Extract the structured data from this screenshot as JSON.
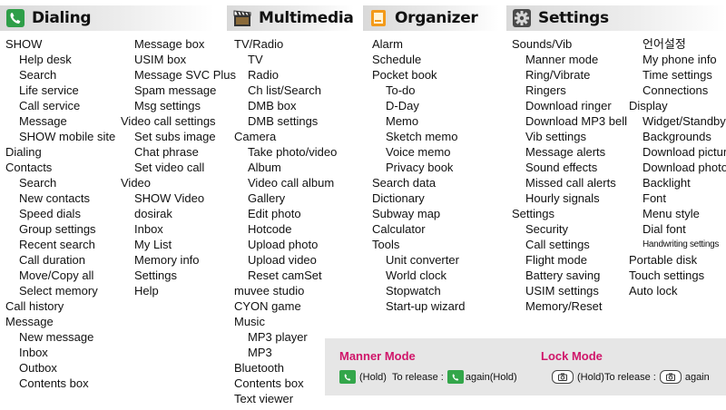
{
  "sections": {
    "dialing": "Dialing",
    "multimedia": "Multimedia",
    "organizer": "Organizer",
    "settings": "Settings"
  },
  "dialing_col1": [
    {
      "t": "SHOW",
      "i": 0
    },
    {
      "t": "Help desk",
      "i": 1
    },
    {
      "t": "Search",
      "i": 1
    },
    {
      "t": "Life service",
      "i": 1
    },
    {
      "t": "Call service",
      "i": 1
    },
    {
      "t": "Message",
      "i": 1
    },
    {
      "t": "SHOW mobile site",
      "i": 1
    },
    {
      "t": "Dialing",
      "i": 0
    },
    {
      "t": "Contacts",
      "i": 0
    },
    {
      "t": "Search",
      "i": 1
    },
    {
      "t": "New contacts",
      "i": 1
    },
    {
      "t": "Speed dials",
      "i": 1
    },
    {
      "t": "Group settings",
      "i": 1
    },
    {
      "t": "Recent search",
      "i": 1
    },
    {
      "t": "Call duration",
      "i": 1
    },
    {
      "t": "Move/Copy all",
      "i": 1
    },
    {
      "t": "Select memory",
      "i": 1
    },
    {
      "t": "Call history",
      "i": 0
    },
    {
      "t": "Message",
      "i": 0
    },
    {
      "t": "New message",
      "i": 1
    },
    {
      "t": "Inbox",
      "i": 1
    },
    {
      "t": "Outbox",
      "i": 1
    },
    {
      "t": "Contents box",
      "i": 1
    }
  ],
  "dialing_col2": [
    {
      "t": "Message box",
      "i": 1
    },
    {
      "t": "USIM box",
      "i": 1
    },
    {
      "t": "Message SVC Plus",
      "i": 1
    },
    {
      "t": "Spam message",
      "i": 1
    },
    {
      "t": "Msg settings",
      "i": 1
    },
    {
      "t": "Video call settings",
      "i": 0
    },
    {
      "t": "Set subs image",
      "i": 1
    },
    {
      "t": "Chat phrase",
      "i": 1
    },
    {
      "t": "Set video call",
      "i": 1
    },
    {
      "t": "Video",
      "i": 0
    },
    {
      "t": "SHOW Video",
      "i": 1
    },
    {
      "t": "dosirak",
      "i": 1
    },
    {
      "t": "Inbox",
      "i": 1
    },
    {
      "t": "My List",
      "i": 1
    },
    {
      "t": "Memory info",
      "i": 1
    },
    {
      "t": "Settings",
      "i": 1
    },
    {
      "t": "Help",
      "i": 1
    }
  ],
  "multimedia_col": [
    {
      "t": "TV/Radio",
      "i": 0
    },
    {
      "t": "TV",
      "i": 1
    },
    {
      "t": "Radio",
      "i": 1
    },
    {
      "t": "Ch list/Search",
      "i": 1
    },
    {
      "t": "DMB box",
      "i": 1
    },
    {
      "t": "DMB settings",
      "i": 1
    },
    {
      "t": "Camera",
      "i": 0
    },
    {
      "t": "Take photo/video",
      "i": 1
    },
    {
      "t": "Album",
      "i": 1
    },
    {
      "t": "Video call album",
      "i": 1
    },
    {
      "t": "Gallery",
      "i": 1
    },
    {
      "t": "Edit photo",
      "i": 1
    },
    {
      "t": "Hotcode",
      "i": 1
    },
    {
      "t": "Upload photo",
      "i": 1
    },
    {
      "t": "Upload video",
      "i": 1
    },
    {
      "t": "Reset camSet",
      "i": 1
    },
    {
      "t": "muvee studio",
      "i": 0
    },
    {
      "t": "CYON game",
      "i": 0
    },
    {
      "t": "Music",
      "i": 0
    },
    {
      "t": "MP3 player",
      "i": 1
    },
    {
      "t": "MP3",
      "i": 1
    },
    {
      "t": "Bluetooth",
      "i": 0
    },
    {
      "t": "Contents box",
      "i": 0
    },
    {
      "t": "Text viewer",
      "i": 0
    }
  ],
  "organizer_col": [
    {
      "t": "Alarm",
      "i": 0
    },
    {
      "t": "Schedule",
      "i": 0
    },
    {
      "t": "Pocket book",
      "i": 0
    },
    {
      "t": "To-do",
      "i": 1
    },
    {
      "t": "D-Day",
      "i": 1
    },
    {
      "t": "Memo",
      "i": 1
    },
    {
      "t": "Sketch memo",
      "i": 1
    },
    {
      "t": "Voice memo",
      "i": 1
    },
    {
      "t": "Privacy book",
      "i": 1
    },
    {
      "t": "Search data",
      "i": 0
    },
    {
      "t": "Dictionary",
      "i": 0
    },
    {
      "t": "Subway map",
      "i": 0
    },
    {
      "t": "Calculator",
      "i": 0
    },
    {
      "t": "Tools",
      "i": 0
    },
    {
      "t": "Unit converter",
      "i": 1
    },
    {
      "t": "World clock",
      "i": 1
    },
    {
      "t": "Stopwatch",
      "i": 1
    },
    {
      "t": "Start-up wizard",
      "i": 1
    }
  ],
  "settings_col1": [
    {
      "t": "Sounds/Vib",
      "i": 0
    },
    {
      "t": "Manner mode",
      "i": 1
    },
    {
      "t": "Ring/Vibrate",
      "i": 1
    },
    {
      "t": "Ringers",
      "i": 1
    },
    {
      "t": "Download ringer",
      "i": 1
    },
    {
      "t": "Download MP3 bell",
      "i": 1
    },
    {
      "t": "Vib settings",
      "i": 1
    },
    {
      "t": "Message alerts",
      "i": 1
    },
    {
      "t": "Sound effects",
      "i": 1
    },
    {
      "t": "Missed call alerts",
      "i": 1
    },
    {
      "t": "Hourly signals",
      "i": 1
    },
    {
      "t": "Settings",
      "i": 0
    },
    {
      "t": "Security",
      "i": 1
    },
    {
      "t": "Call settings",
      "i": 1
    },
    {
      "t": "Flight mode",
      "i": 1
    },
    {
      "t": "Battery saving",
      "i": 1
    },
    {
      "t": "USIM settings",
      "i": 1
    },
    {
      "t": "Memory/Reset",
      "i": 1
    }
  ],
  "settings_col2": [
    {
      "t": "언어설정",
      "i": 1
    },
    {
      "t": "My phone info",
      "i": 1
    },
    {
      "t": "Time settings",
      "i": 1
    },
    {
      "t": "Connections",
      "i": 1
    },
    {
      "t": "Display",
      "i": 0
    },
    {
      "t": "Widget/Standby",
      "i": 1
    },
    {
      "t": "Backgrounds",
      "i": 1
    },
    {
      "t": "Download picture",
      "i": 1
    },
    {
      "t": "Download photo",
      "i": 1
    },
    {
      "t": "Backlight",
      "i": 1
    },
    {
      "t": "Font",
      "i": 1
    },
    {
      "t": "Menu style",
      "i": 1
    },
    {
      "t": "Dial font",
      "i": 1
    },
    {
      "t": "Handwriting settings",
      "i": 1,
      "s": 1
    },
    {
      "t": "Portable disk",
      "i": 0
    },
    {
      "t": "Touch settings",
      "i": 0
    },
    {
      "t": "Auto lock",
      "i": 0
    }
  ],
  "modes": {
    "manner": {
      "title": "Manner Mode",
      "hold": "(Hold)",
      "release": "To release :",
      "again": "again(Hold)"
    },
    "lock": {
      "title": "Lock Mode",
      "hold": "(Hold)To release :",
      "again": "again"
    }
  },
  "icons": {
    "dialing": "phone-icon",
    "multimedia": "clapperboard-icon",
    "organizer": "notepad-icon",
    "settings": "gear-icon",
    "lock_key": "camera-key-icon"
  },
  "colors": {
    "mode_title": "#d0166a",
    "call_key": "#33a64a"
  }
}
